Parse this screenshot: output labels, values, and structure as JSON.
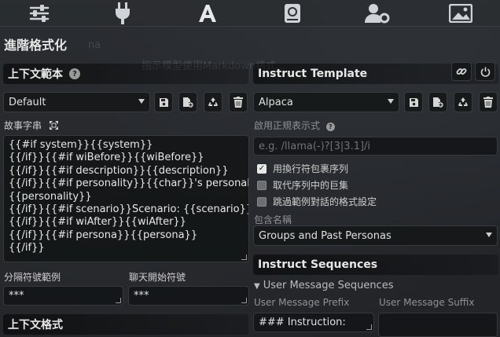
{
  "topnav": {
    "icons": [
      "sliders-icon",
      "plug-icon",
      "font-icon",
      "book-globe-icon",
      "user-gear-icon",
      "image-icon"
    ]
  },
  "panel": {
    "title": "進階格式化",
    "background_ghost_1": "na",
    "background_ghost_2": "指示模型使用Markdown格式..."
  },
  "context_template": {
    "header": "上下文範本",
    "preset_value": "Default",
    "story_string_label": "故事字串",
    "story_string_lines": [
      "{{#if system}}{{system}}",
      "{{/if}}{{#if wiBefore}}{{wiBefore}}",
      "{{/if}}{{#if description}}{{description}}",
      "{{/if}}{{#if personality}}{{char}}'s personality:",
      "{{personality}}",
      "{{/if}}{{#if scenario}}Scenario: {{scenario}}",
      "{{/if}}{{#if wiAfter}}{{wiAfter}}",
      "{{/if}}{{#if persona}}{{persona}}",
      "{{/if}}"
    ],
    "separator_label": "分隔符號範例",
    "separator_value": "***",
    "chat_start_label": "聊天開始符號",
    "chat_start_value": "***",
    "context_format_header": "上下文格式"
  },
  "instruct_template": {
    "header": "Instruct Template",
    "preset_value": "Alpaca",
    "regex_label": "啟用正規表示式",
    "regex_placeholder": "e.g. /llama(-)?[3|3.1]/i",
    "checkboxes": [
      {
        "label": "用換行符包裹序列",
        "checked": true
      },
      {
        "label": "取代序列中的巨集",
        "checked": false
      },
      {
        "label": "跳過範例對話的格式設定",
        "checked": false
      }
    ],
    "include_names_label": "包含名稱",
    "include_names_value": "Groups and Past Personas",
    "sequences_header": "Instruct Sequences",
    "user_seq_toggle": "User Message Sequences",
    "user_prefix_label": "User Message Prefix",
    "user_prefix_value": "### Instruction:",
    "user_suffix_label": "User Message Suffix",
    "user_suffix_value": ""
  }
}
